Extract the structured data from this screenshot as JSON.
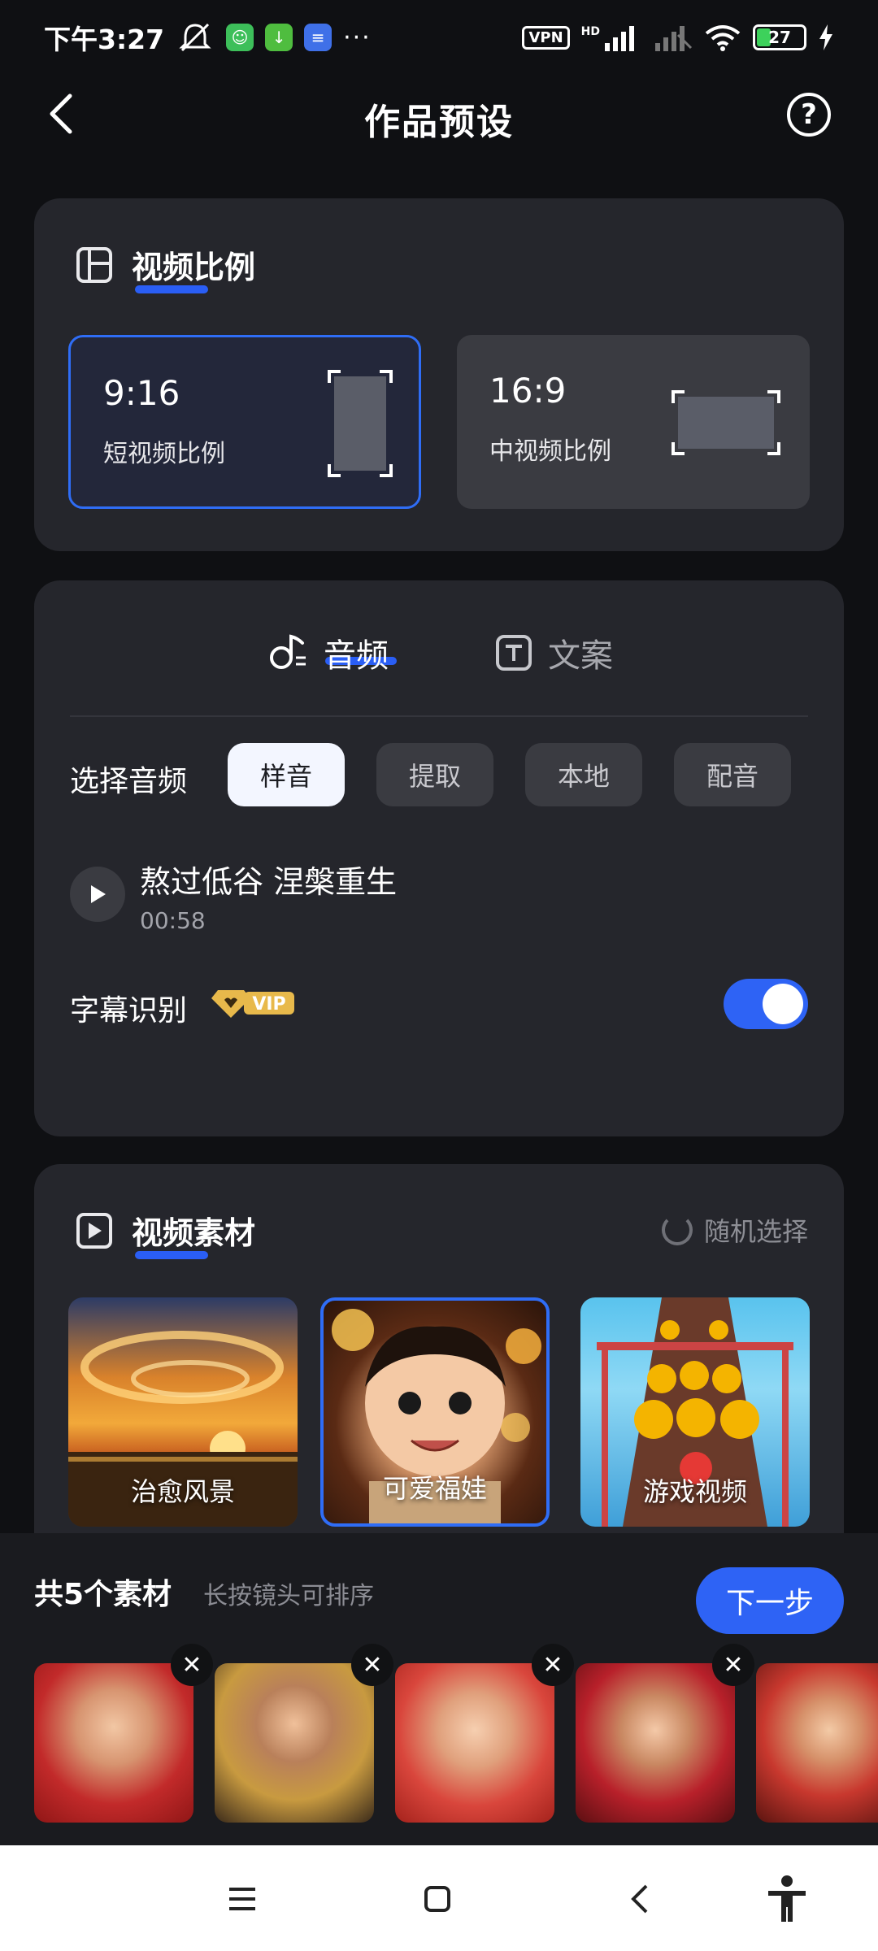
{
  "status_bar": {
    "time": "下午3:27",
    "more": "···",
    "vpn": "VPN",
    "hd": "HD",
    "battery": "27"
  },
  "header": {
    "title": "作品预设",
    "help": "?"
  },
  "aspect": {
    "title": "视频比例",
    "options": [
      {
        "ratio": "9:16",
        "label": "短视频比例",
        "selected": true
      },
      {
        "ratio": "16:9",
        "label": "中视频比例",
        "selected": false
      }
    ]
  },
  "audio": {
    "tabs": [
      {
        "label": "音频",
        "active": true
      },
      {
        "label": "文案",
        "active": false
      }
    ],
    "choose_label": "选择音频",
    "sources": [
      "样音",
      "提取",
      "本地",
      "配音"
    ],
    "active_source": "样音",
    "track": {
      "name": "熬过低谷 涅槃重生",
      "duration": "00:58"
    },
    "subtitle_label": "字幕识别",
    "vip": "VIP",
    "subtitle_enabled": true
  },
  "material": {
    "title": "视频素材",
    "random_label": "随机选择",
    "categories": [
      {
        "label": "治愈风景",
        "selected": false
      },
      {
        "label": "可爱福娃",
        "selected": true
      },
      {
        "label": "游戏视频",
        "selected": false
      }
    ]
  },
  "bottom": {
    "count_label": "共5个素材",
    "hint": "长按镜头可排序",
    "next_label": "下一步",
    "remove": "✕"
  },
  "colors": {
    "accent": "#2e63f5",
    "background": "#0f1013",
    "card": "#25262c"
  }
}
